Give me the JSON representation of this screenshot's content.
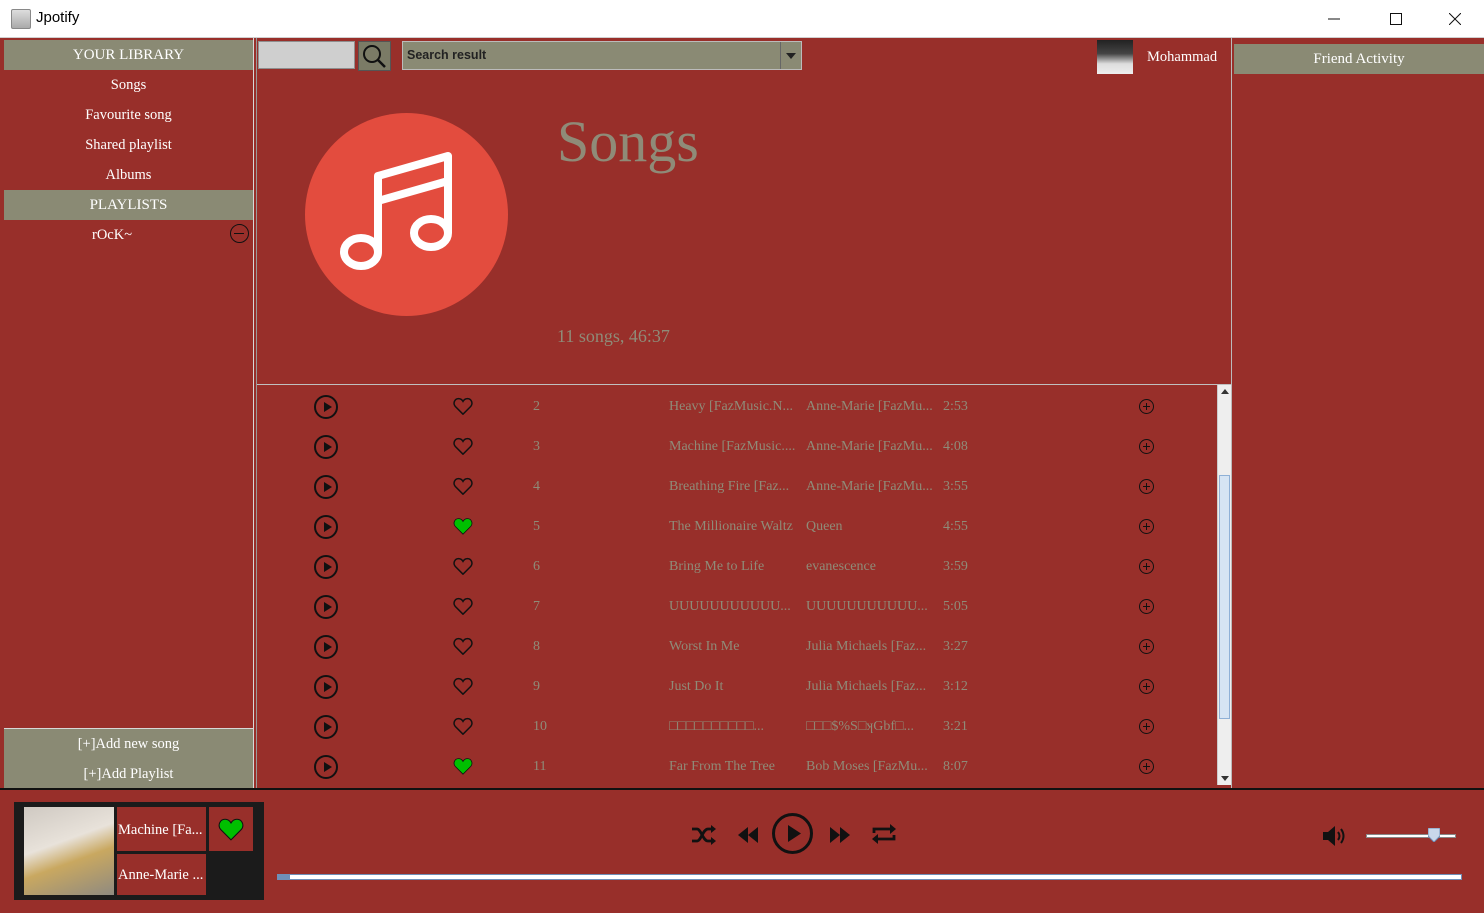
{
  "window": {
    "title": "Jpotify",
    "minimize_label": "—",
    "maximize_label": "☐",
    "close_label": "✕"
  },
  "sidebar": {
    "library_header": "YOUR LIBRARY",
    "items": [
      {
        "label": "Songs"
      },
      {
        "label": "Favourite song"
      },
      {
        "label": "Shared playlist"
      },
      {
        "label": "Albums"
      }
    ],
    "playlists_header": "PLAYLISTS",
    "playlists": [
      {
        "label": "rOcK~"
      }
    ],
    "add_song_label": "[+]Add new song",
    "add_playlist_label": "[+]Add Playlist"
  },
  "search": {
    "value": "",
    "select_value": "Search result"
  },
  "user": {
    "name": "Mohammad"
  },
  "header": {
    "title": "Songs",
    "subtitle": "11 songs, 46:37"
  },
  "songs": [
    {
      "num": "2",
      "title": "Heavy [FazMusic.N...",
      "artist": "Anne-Marie [FazMu...",
      "time": "2:53",
      "liked": false
    },
    {
      "num": "3",
      "title": "Machine [FazMusic....",
      "artist": "Anne-Marie [FazMu...",
      "time": "4:08",
      "liked": false
    },
    {
      "num": "4",
      "title": "Breathing Fire [Faz...",
      "artist": "Anne-Marie [FazMu...",
      "time": "3:55",
      "liked": false
    },
    {
      "num": "5",
      "title": "The Millionaire Waltz",
      "artist": "Queen",
      "time": "4:55",
      "liked": true
    },
    {
      "num": "6",
      "title": "Bring Me to Life",
      "artist": "evanescence",
      "time": "3:59",
      "liked": false
    },
    {
      "num": "7",
      "title": "UUUUUUUUUUU...",
      "artist": "UUUUUUUUUUU...",
      "time": "5:05",
      "liked": false
    },
    {
      "num": "8",
      "title": "Worst In Me",
      "artist": "Julia Michaels [Faz...",
      "time": "3:27",
      "liked": false
    },
    {
      "num": "9",
      "title": "Just Do It",
      "artist": "Julia Michaels [Faz...",
      "time": "3:12",
      "liked": false
    },
    {
      "num": "10",
      "title": "□□□□□□□□□□...",
      "artist": "□□□$%S□ʞGbf□...",
      "time": "3:21",
      "liked": false
    },
    {
      "num": "11",
      "title": "Far From The Tree",
      "artist": "Bob Moses [FazMu...",
      "time": "8:07",
      "liked": true
    }
  ],
  "friends": {
    "header": "Friend Activity"
  },
  "now_playing": {
    "title": "Machine [Fa...",
    "artist": "Anne-Marie ...",
    "liked": true,
    "progress": 0.01,
    "volume": 0.7
  },
  "colors": {
    "background": "#982f2a",
    "header_bar": "#8a8a74",
    "muted_text": "#8f8b78",
    "accent_red": "#e34c3e",
    "liked_green": "#00c000"
  }
}
